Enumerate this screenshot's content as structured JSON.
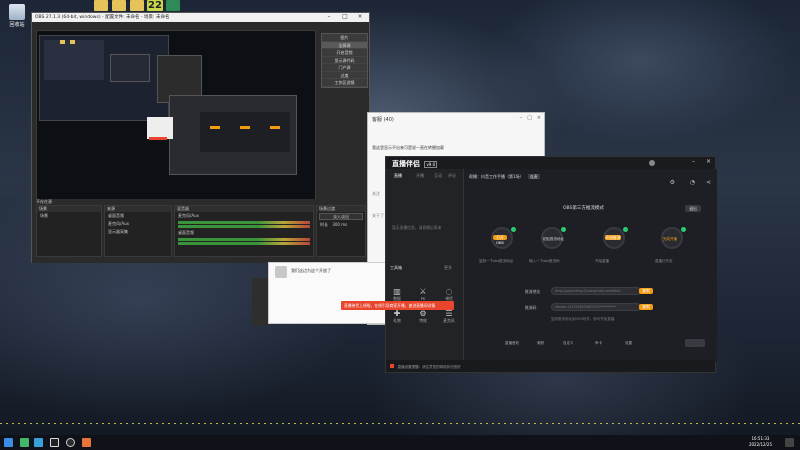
{
  "desktop": {
    "icons": [
      {
        "label": "回收站"
      }
    ]
  },
  "top_strip": {
    "badge_number": "22"
  },
  "obs": {
    "title": "OBS 27.1.3 (64-bit, windows) - 配置文件: 未命名 - 场景: 未命名",
    "context_menu": [
      "图片",
      "全屏源",
      "开启音频",
      "显示源代码",
      "门户源",
      "过度",
      "工作区滤镜",
      "变换"
    ],
    "docks": {
      "scenes": {
        "title": "场景",
        "items": [
          "场景"
        ]
      },
      "sources": {
        "title": "来源",
        "items": [
          "桌面音频",
          "麦克风/Aux",
          "显示器采集"
        ]
      },
      "mixer": {
        "title": "混音器",
        "tracks": [
          "麦克风/Aux",
          "桌面音频"
        ]
      },
      "transitions": {
        "title": "场景过渡",
        "value": "淡入淡出",
        "duration_label": "时长",
        "duration": "300 ms"
      }
    },
    "left_label": "不存在源"
  },
  "chat_window": {
    "title": "客服 (40)",
    "message": "我这里显示不出来可是说一直在转圈加载",
    "list": [
      "关注",
      "关于了"
    ]
  },
  "chat_small": {
    "line1": "我们这边为这个开放了"
  },
  "stream_app": {
    "logo": "直播伴侣",
    "version": "v9.0",
    "nav_tabs": [
      "直播",
      "开播",
      "互动",
      "评论"
    ],
    "title": "帮播：抖音工作手播（第1场）",
    "status_tag": "连麦",
    "main_heading": "OBS第三方推流模式",
    "right_button": "退出",
    "steps": [
      {
        "label": "打开OBS",
        "caption": "复制一下obs推流地址"
      },
      {
        "label": "粘贴推流地址",
        "caption": "输入一下obs推流码"
      },
      {
        "label": "开启推流",
        "caption": "开始直播"
      },
      {
        "label": "完成开播",
        "caption": "直播已开启"
      }
    ],
    "fields": [
      {
        "label": "推流地址",
        "value": "rtmp://push-rtmp-l3.douyincdn.com/third",
        "button": "复制"
      },
      {
        "label": "推流码",
        "value": "stream-1127548939857523**********",
        "button": "复制"
      }
    ],
    "hint": "复制推流地址到OBS软件，即可开始直播",
    "left_section": {
      "title": "工具箱",
      "more": "更多",
      "empty_hint": "暂无直播信息，请直播后再来"
    },
    "tools": [
      {
        "icon": "bar-chart-icon",
        "label": "数据"
      },
      {
        "icon": "pk-icon",
        "label": "PK"
      },
      {
        "icon": "shopping-icon",
        "label": "带货"
      },
      {
        "icon": "gift-icon",
        "label": "礼物"
      },
      {
        "icon": "wand-icon",
        "label": "特效"
      },
      {
        "icon": "mic-icon",
        "label": "麦克风"
      }
    ],
    "bottom_bar": [
      "直播音效",
      "美颜",
      "自定义",
      "声卡",
      "设置"
    ],
    "footer_notice": "直播设置提醒：请注意您的网络状况良好"
  },
  "toast": {
    "text": "直播带货上线啦，在线引导商家开播，速进直播间详情"
  },
  "taskbar": {
    "time": "16:51:33",
    "date": "2022/12/25"
  }
}
